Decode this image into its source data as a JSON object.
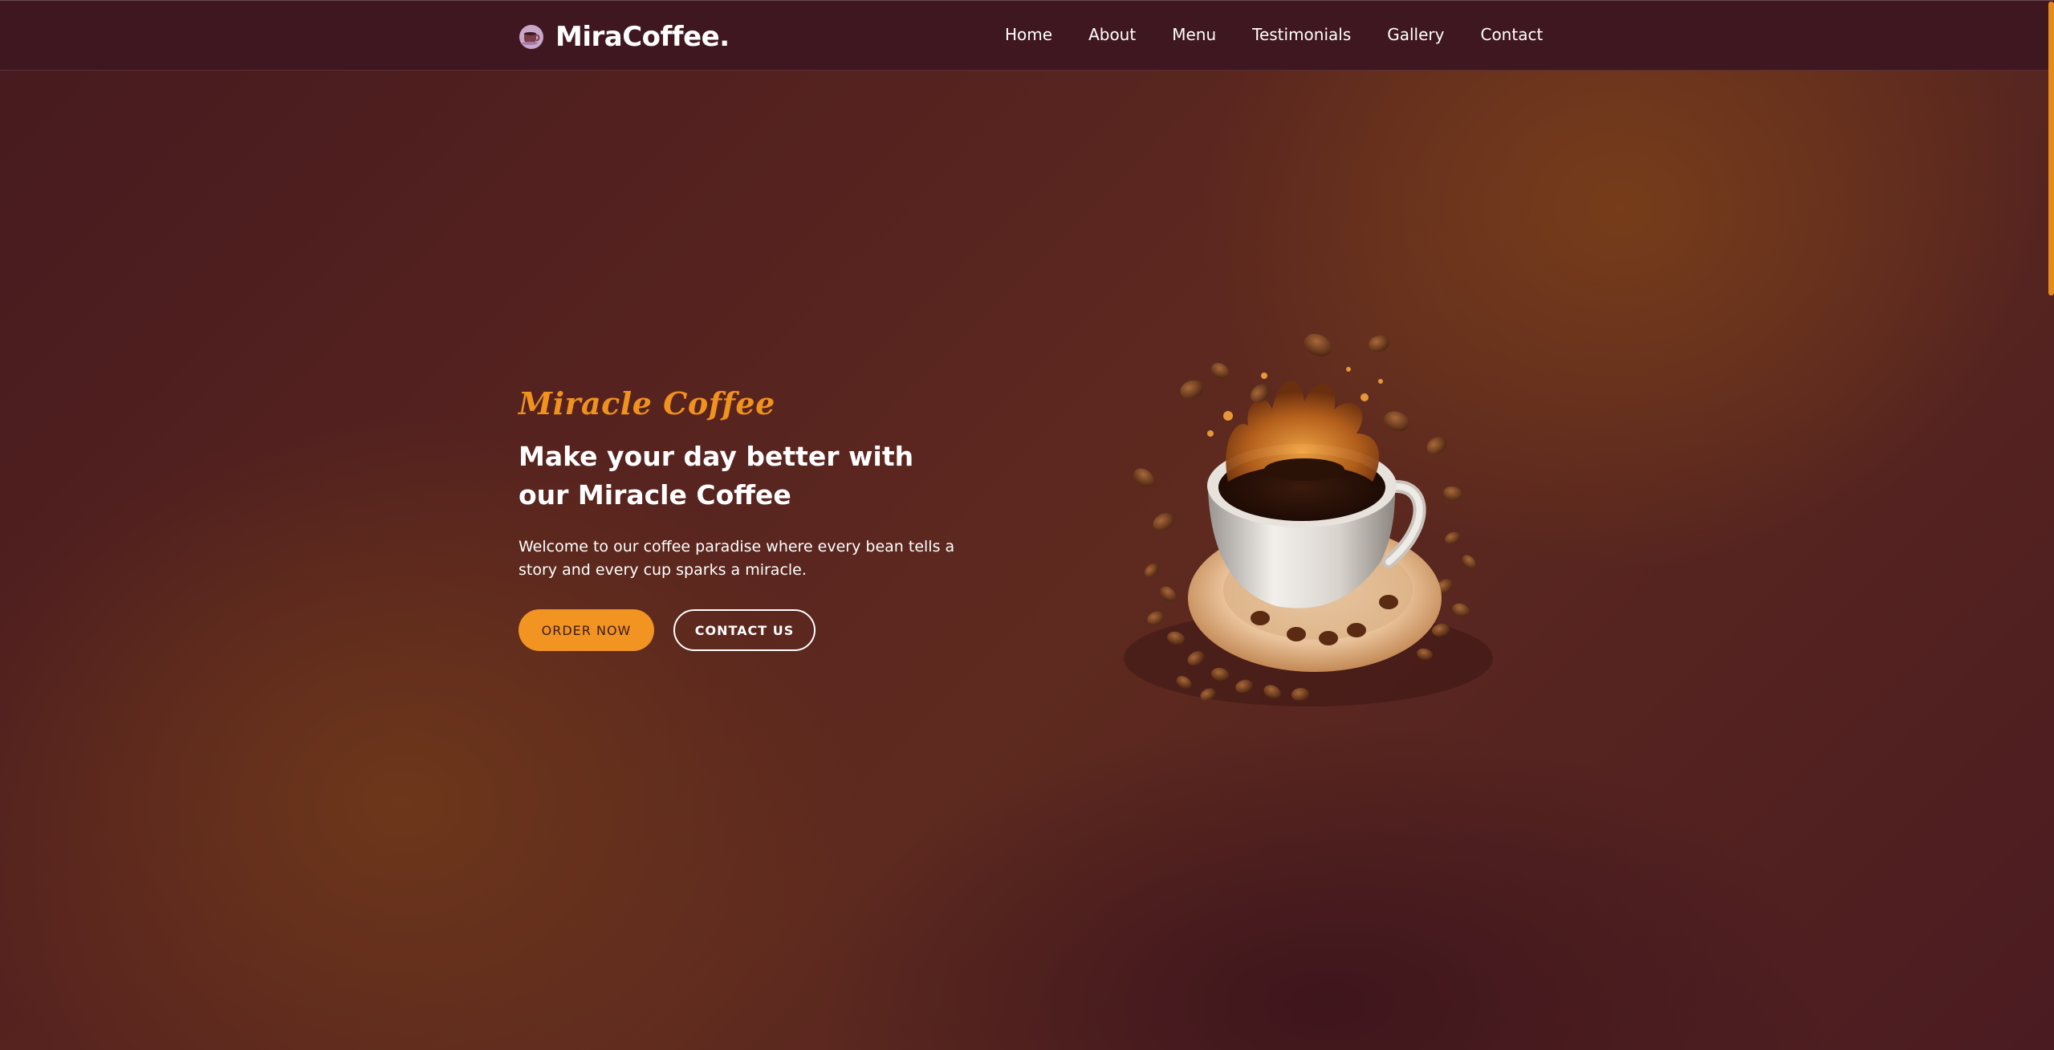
{
  "navbar": {
    "brand": "MiraCoffee.",
    "brand_icon": "coffee-cup-icon",
    "links": [
      "Home",
      "About",
      "Menu",
      "Testimonials",
      "Gallery",
      "Contact"
    ]
  },
  "hero": {
    "tagline": "Miracle Coffee",
    "headline": "Make your day better with our Miracle Coffee",
    "description": "Welcome to our coffee paradise where every bean tells a story and every cup sparks a miracle.",
    "primary_button": "Order Now",
    "secondary_button": "Contact Us",
    "image": "coffee-splash-image"
  },
  "colors": {
    "accent": "#f19422",
    "nav_background": "#3f1720",
    "hero_background": "#57231f",
    "text": "#ffffff"
  }
}
